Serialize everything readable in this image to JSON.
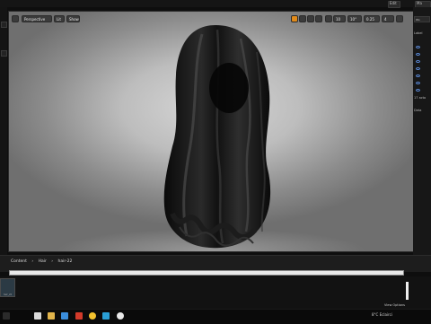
{
  "topbar": {
    "right_labels": [
      "Edit",
      "Ma"
    ]
  },
  "viewport": {
    "perspective_label": "Perspective",
    "lit_label": "Lit",
    "show_label": "Show",
    "grid_snap": "10",
    "rot_snap": "10°",
    "scale_snap": "0.25",
    "camera_speed": "4"
  },
  "right_panel": {
    "tab_label": "Wo",
    "label_text": "Label",
    "count_text": "17 acto",
    "details_text": "Deta"
  },
  "content_browser": {
    "breadcrumb": [
      "Content",
      "Hair",
      "hair-22"
    ],
    "view_options": "View Options",
    "thumb_label": "hair_22"
  },
  "taskbar": {
    "tray_text": "8°C Eclairci"
  },
  "colors": {
    "accent_orange": "#e08a1a",
    "viewport_bg": "#c4c4c4",
    "hair": "#0d0d0d"
  }
}
